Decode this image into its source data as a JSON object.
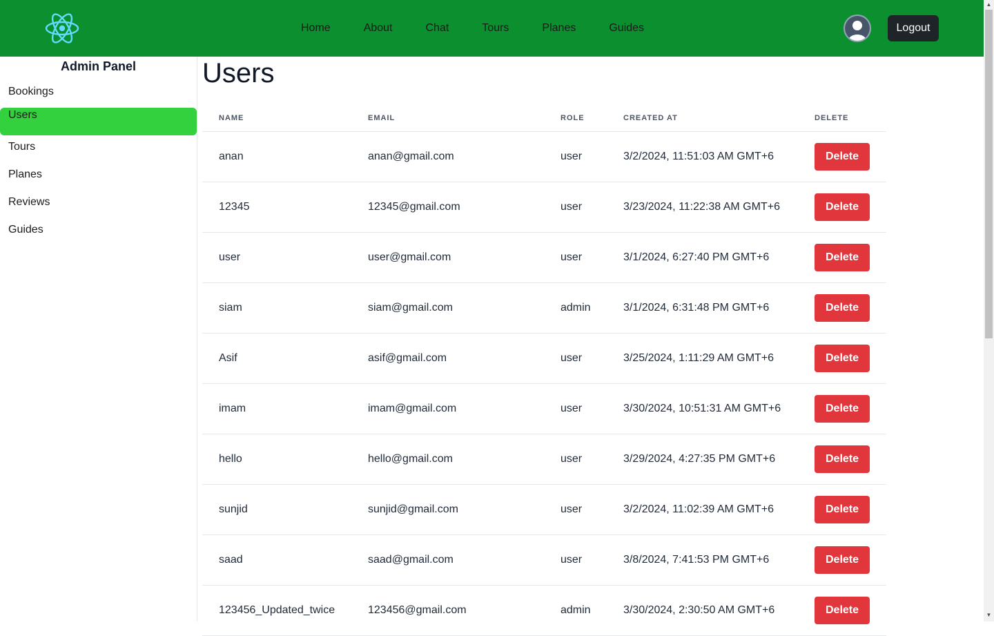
{
  "navbar": {
    "logo_icon": "react-atom-icon",
    "links": [
      "Home",
      "About",
      "Chat",
      "Tours",
      "Planes",
      "Guides"
    ],
    "avatar_icon": "user-avatar-icon",
    "logout_label": "Logout",
    "bg_color": "#0c8f2f"
  },
  "sidebar": {
    "title": "Admin Panel",
    "items": [
      "Bookings",
      "Users",
      "Tours",
      "Planes",
      "Reviews",
      "Guides"
    ],
    "active_item": "Users",
    "active_color": "#33d13d"
  },
  "main": {
    "title": "Users",
    "table": {
      "headers": [
        "NAME",
        "EMAIL",
        "ROLE",
        "CREATED AT",
        "DELETE"
      ],
      "delete_label": "Delete",
      "delete_color": "#e0363c",
      "rows": [
        {
          "name": "anan",
          "email": "anan@gmail.com",
          "role": "user",
          "created_at": "3/2/2024, 11:51:03 AM GMT+6"
        },
        {
          "name": "12345",
          "email": "12345@gmail.com",
          "role": "user",
          "created_at": "3/23/2024, 11:22:38 AM GMT+6"
        },
        {
          "name": "user",
          "email": "user@gmail.com",
          "role": "user",
          "created_at": "3/1/2024, 6:27:40 PM GMT+6"
        },
        {
          "name": "siam",
          "email": "siam@gmail.com",
          "role": "admin",
          "created_at": "3/1/2024, 6:31:48 PM GMT+6"
        },
        {
          "name": "Asif",
          "email": "asif@gmail.com",
          "role": "user",
          "created_at": "3/25/2024, 1:11:29 AM GMT+6"
        },
        {
          "name": "imam",
          "email": "imam@gmail.com",
          "role": "user",
          "created_at": "3/30/2024, 10:51:31 AM GMT+6"
        },
        {
          "name": "hello",
          "email": "hello@gmail.com",
          "role": "user",
          "created_at": "3/29/2024, 4:27:35 PM GMT+6"
        },
        {
          "name": "sunjid",
          "email": "sunjid@gmail.com",
          "role": "user",
          "created_at": "3/2/2024, 11:02:39 AM GMT+6"
        },
        {
          "name": "saad",
          "email": "saad@gmail.com",
          "role": "user",
          "created_at": "3/8/2024, 7:41:53 PM GMT+6"
        },
        {
          "name": "123456_Updated_twice",
          "email": "123456@gmail.com",
          "role": "admin",
          "created_at": "3/30/2024, 2:30:50 AM GMT+6"
        }
      ]
    }
  }
}
